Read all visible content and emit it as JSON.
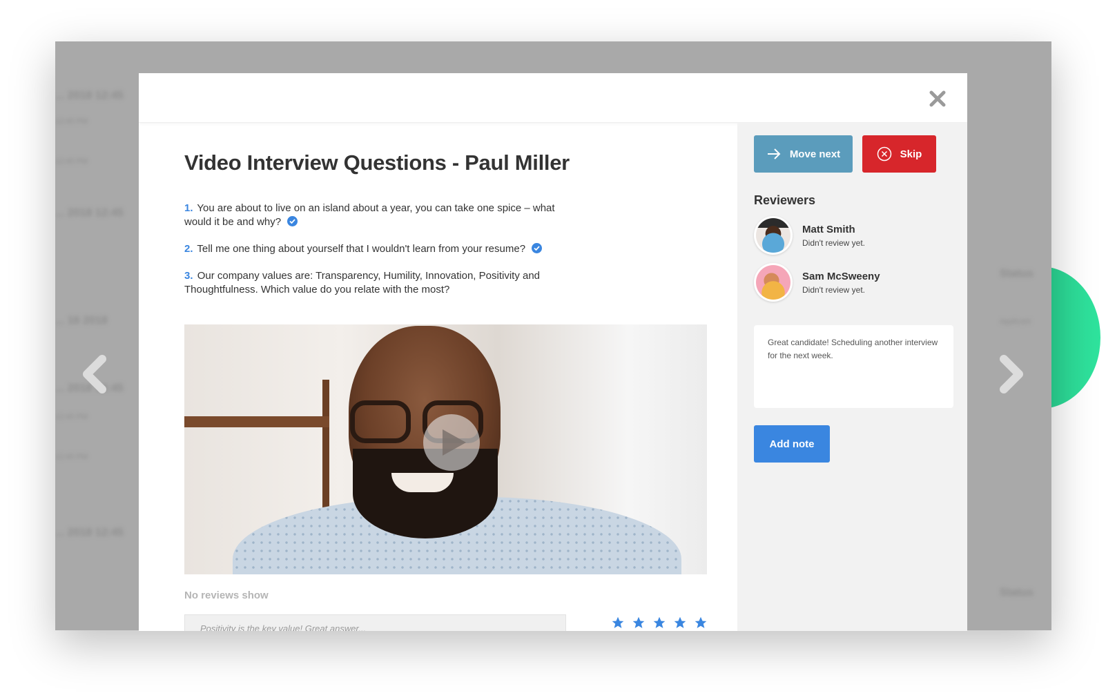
{
  "modal": {
    "title": "Video Interview Questions - Paul Miller",
    "close_icon": "close-icon",
    "questions": [
      {
        "number": "1.",
        "text": "You are about to live on an island about a year, you can take one spice – what would it be and why?",
        "answered": true
      },
      {
        "number": "2.",
        "text": "Tell me one thing about yourself that I wouldn't learn from your resume?",
        "answered": true
      },
      {
        "number": "3.",
        "text": "Our company values are: Transparency, Humility, Innovation, Positivity and Thoughtfulness. Which value do you relate with the most?",
        "answered": false
      }
    ],
    "video": {
      "play_icon": "play-icon"
    },
    "reviews": {
      "empty_label": "No reviews show",
      "review_input_value": "Positivity is the key value! Great answer...",
      "rating": 5,
      "rating_max": 5
    }
  },
  "sidebar": {
    "move_next_label": "Move next",
    "skip_label": "Skip",
    "reviewers_title": "Reviewers",
    "reviewers": [
      {
        "name": "Matt Smith",
        "status": "Didn't review yet."
      },
      {
        "name": "Sam McSweeny",
        "status": "Didn't review yet."
      }
    ],
    "note_value": "Great candidate! Scheduling another interview for the next week.",
    "add_note_label": "Add note"
  },
  "background": {
    "rows": [
      "... 2018 12:45",
      "12:45 PM",
      "12:45 PM",
      "... 2018 12:45",
      "... 16 2018",
      "... 2018 12:45",
      "12:45 PM",
      "12:45 PM",
      "... 2018 12:45"
    ],
    "right_labels": [
      "Status",
      "Applicant",
      "Status"
    ]
  },
  "colors": {
    "accent_blue": "#3a86e0",
    "move_next": "#5b9cbc",
    "skip_red": "#d7262b",
    "decor_green": "#2fe39d"
  }
}
